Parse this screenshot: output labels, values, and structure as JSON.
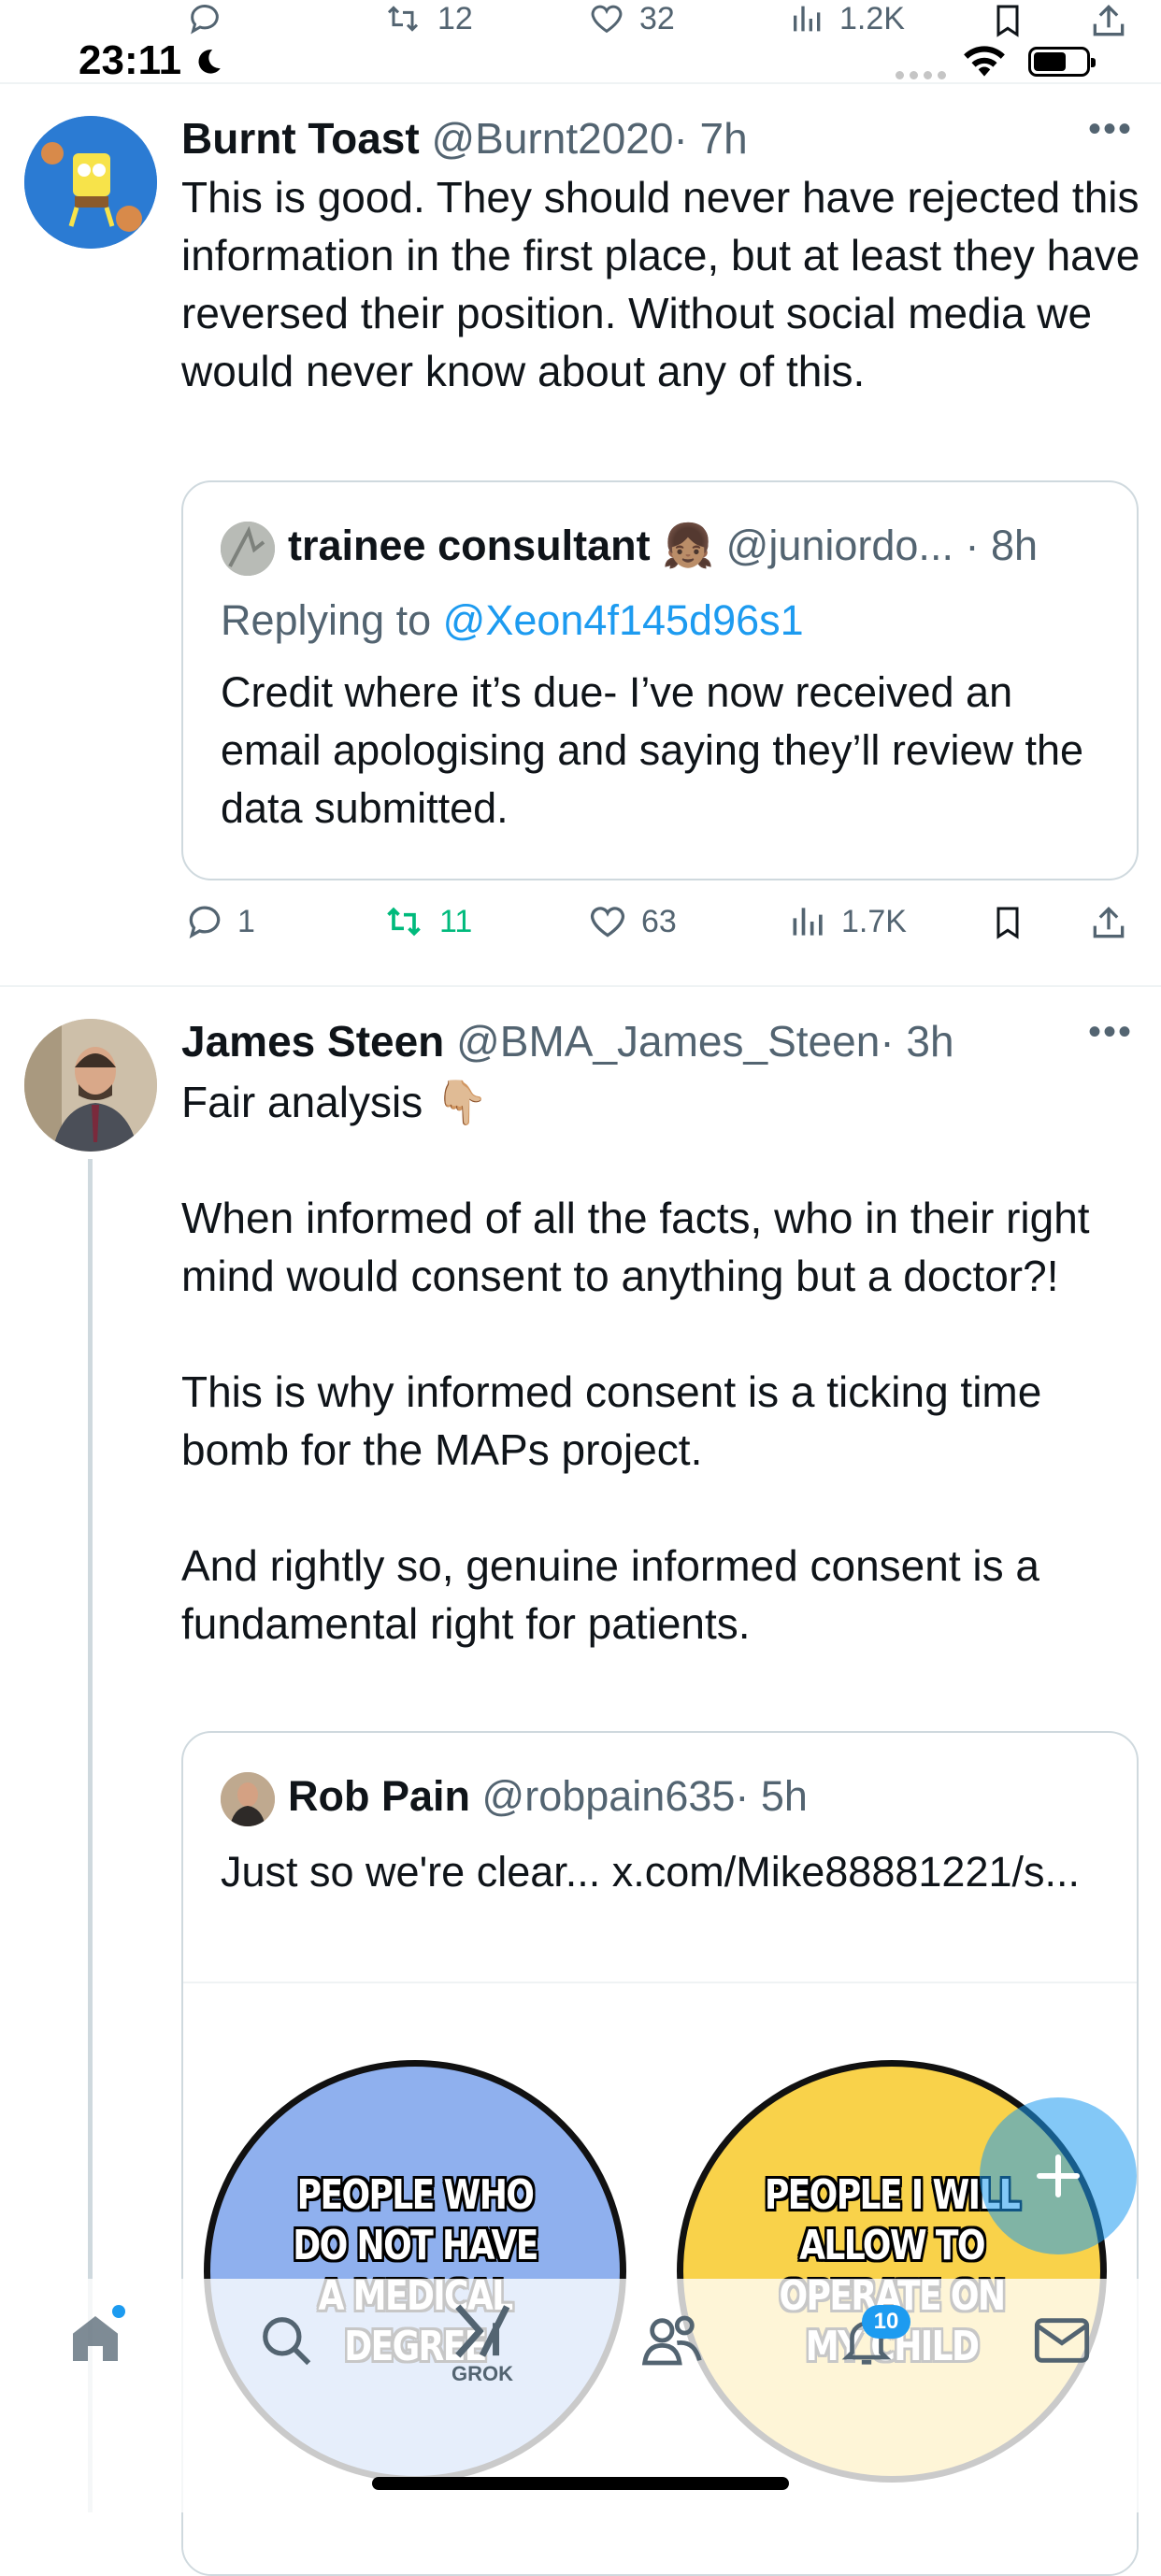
{
  "status_bar": {
    "time": "23:11"
  },
  "prev_actions": {
    "retweets": "12",
    "likes": "32",
    "views": "1.2K"
  },
  "tweet1": {
    "name": "Burnt Toast",
    "handle": "@Burnt2020",
    "time": "· 7h",
    "text": "This is good. They should never have rejected this information in the first place, but at least they have reversed their position. Without social media we would never know about any of this.",
    "quote": {
      "name": "trainee consultant",
      "emoji": "👧🏽",
      "handle": "@juniordo...",
      "time": "· 8h",
      "replying_prefix": "Replying to",
      "replying_handle": "@Xeon4f145d96s1",
      "text": "Credit where it’s due- I’ve now received an email apologising and saying they’ll review the data submitted."
    },
    "actions": {
      "replies": "1",
      "retweets": "11",
      "likes": "63",
      "views": "1.7K"
    }
  },
  "tweet2": {
    "name": "James Steen",
    "handle": "@BMA_James_Steen",
    "time": "· 3h",
    "text": "Fair analysis 👇🏼\n\nWhen informed of all the facts, who in their right mind would consent to anything but a doctor?!\n\nThis is why informed consent is a ticking time bomb for the MAPs project.\n\nAnd rightly so, genuine informed consent is a fundamental right for patients.",
    "quote": {
      "name": "Rob Pain",
      "handle": "@robpain635",
      "time": "· 5h",
      "text": "Just so we're clear... x.com/Mike88881221/s...",
      "meme": {
        "left_label": "PEOPLE WHO DO NOT HAVE A MEDICAL DEGREE",
        "right_label": "PEOPLE I WILL ALLOW TO OPERATE ON MY CHILD"
      }
    }
  },
  "bottom_nav": {
    "grok_label": "GROK",
    "notifications_badge": "10"
  },
  "colors": {
    "accent": "#1d9bf0",
    "retweet_active": "#00ba7c",
    "muted": "#536471",
    "border": "#cfd9de"
  }
}
